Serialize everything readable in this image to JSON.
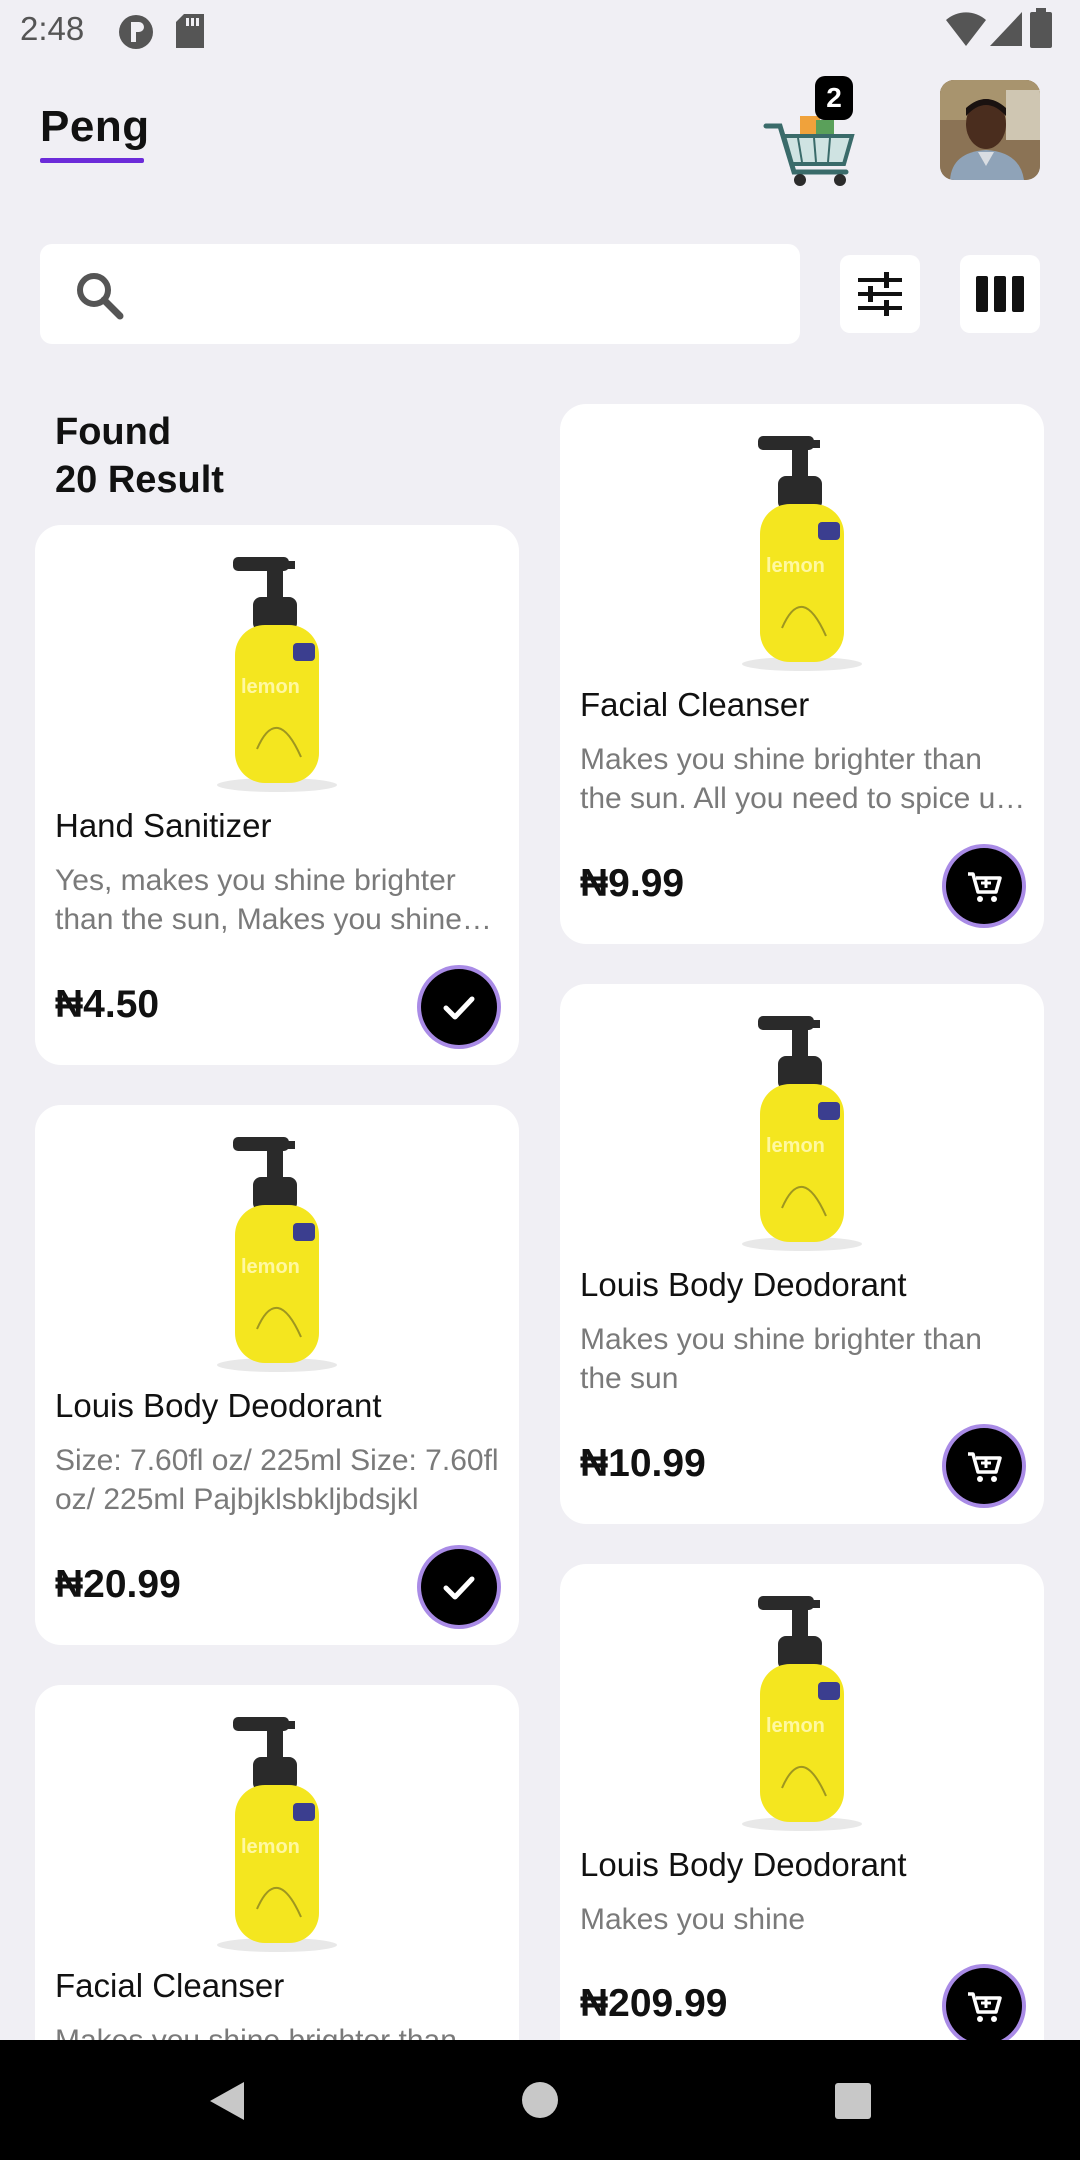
{
  "status_bar": {
    "time": "2:48",
    "left_icons": [
      "p-circle-icon",
      "sd-card-icon"
    ],
    "right_icons": [
      "wifi-icon",
      "signal-icon",
      "battery-icon"
    ]
  },
  "header": {
    "brand": "Peng",
    "cart_count": "2",
    "accent_color": "#6c2bd9"
  },
  "search": {
    "value": "",
    "placeholder": ""
  },
  "toolbar": {
    "filter_icon": "tune-icon",
    "layout_icon": "columns-icon"
  },
  "results": {
    "line1": "Found",
    "line2": "20 Result"
  },
  "products_left": [
    {
      "title": "Hand Sanitizer",
      "desc": "Yes, makes you shine brighter than the sun, Makes you shine brighter than the sun",
      "price": "₦4.50",
      "action": "check-icon"
    },
    {
      "title": "Louis Body Deodorant",
      "desc": "Size: 7.60fl oz/ 225ml Size: 7.60fl oz/ 225ml Pajbjklsbkljbdsjkl",
      "price": "₦20.99",
      "action": "check-icon"
    },
    {
      "title": "Facial Cleanser",
      "desc": "Makes you shine brighter than the sun. All you need to spice up",
      "price": "",
      "action": ""
    }
  ],
  "products_right": [
    {
      "title": "Facial Cleanser",
      "desc": "Makes you shine brighter than the sun. All you need to spice up your day",
      "price": "₦9.99",
      "action": "add-cart-icon"
    },
    {
      "title": "Louis Body Deodorant",
      "desc": "Makes you shine brighter than the sun",
      "price": "₦10.99",
      "action": "add-cart-icon"
    },
    {
      "title": "Louis Body Deodorant",
      "desc": "Makes you shine",
      "price": "₦209.99",
      "action": "add-cart-icon"
    }
  ],
  "nav_bar": {
    "buttons": [
      "back-icon",
      "home-icon",
      "recents-icon"
    ]
  }
}
